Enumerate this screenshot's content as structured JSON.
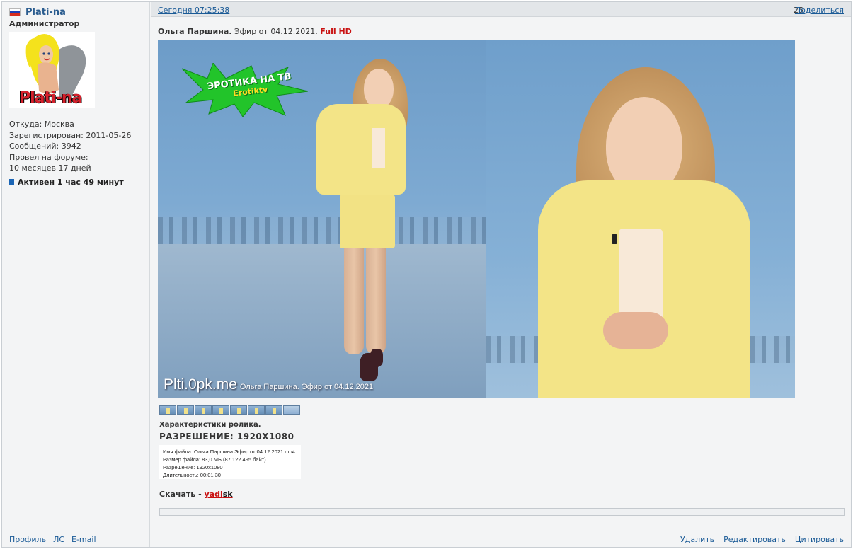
{
  "author": {
    "name": "Plati-na",
    "rank": "Администратор",
    "avatar_text": "Plati-na",
    "from": "Откуда: Москва",
    "registered": "Зарегистрирован: 2011-05-26",
    "posts": "Сообщений: 3942",
    "spent_label": "Провел на форуме:",
    "spent_value": "10 месяцев 17 дней",
    "active": "Активен 1 час 49 минут",
    "links": {
      "profile": "Профиль",
      "pm": "ЛС",
      "email": "E-mail"
    }
  },
  "post": {
    "date": "Сегодня 07:25:38",
    "number": "25",
    "share": "Поделиться",
    "title_bold": "Ольга Паршина.",
    "title_rest": " Эфир от 04.12.2021. ",
    "title_hd": "Full HD",
    "badge_top": "ЭРОТИКА НА ТВ",
    "badge_sub": "Erotiktv",
    "watermark_site": "Plti.0pk.me",
    "watermark_caption": "Ольга Паршина. Эфир от 04.12.2021",
    "specs_heading": "Характеристики ролика.",
    "resolution": "РАЗРЕШЕНИЕ: 1920X1080",
    "mediainfo": {
      "filename": "Имя файла: Ольга Паршина Эфир от 04 12 2021.mp4",
      "size": "Размер файла: 83,0 МБ (87 122 495 байт)",
      "resolution": "Разрешение: 1920x1080",
      "duration": "Длительность: 00:01:30"
    },
    "download_label": "Скачать - ",
    "download_link_red": "yadi",
    "download_link_black": "sk"
  },
  "actions": {
    "delete": "Удалить",
    "edit": "Редактировать",
    "quote": "Цитировать"
  },
  "colors": {
    "link": "#1a5a96",
    "accent_red": "#c91111",
    "flag": [
      "#ffffff",
      "#1c3eb5",
      "#d52b1e"
    ]
  },
  "icons": [
    "russia-flag-icon",
    "online-status-icon",
    "video-thumbnail-icon"
  ]
}
